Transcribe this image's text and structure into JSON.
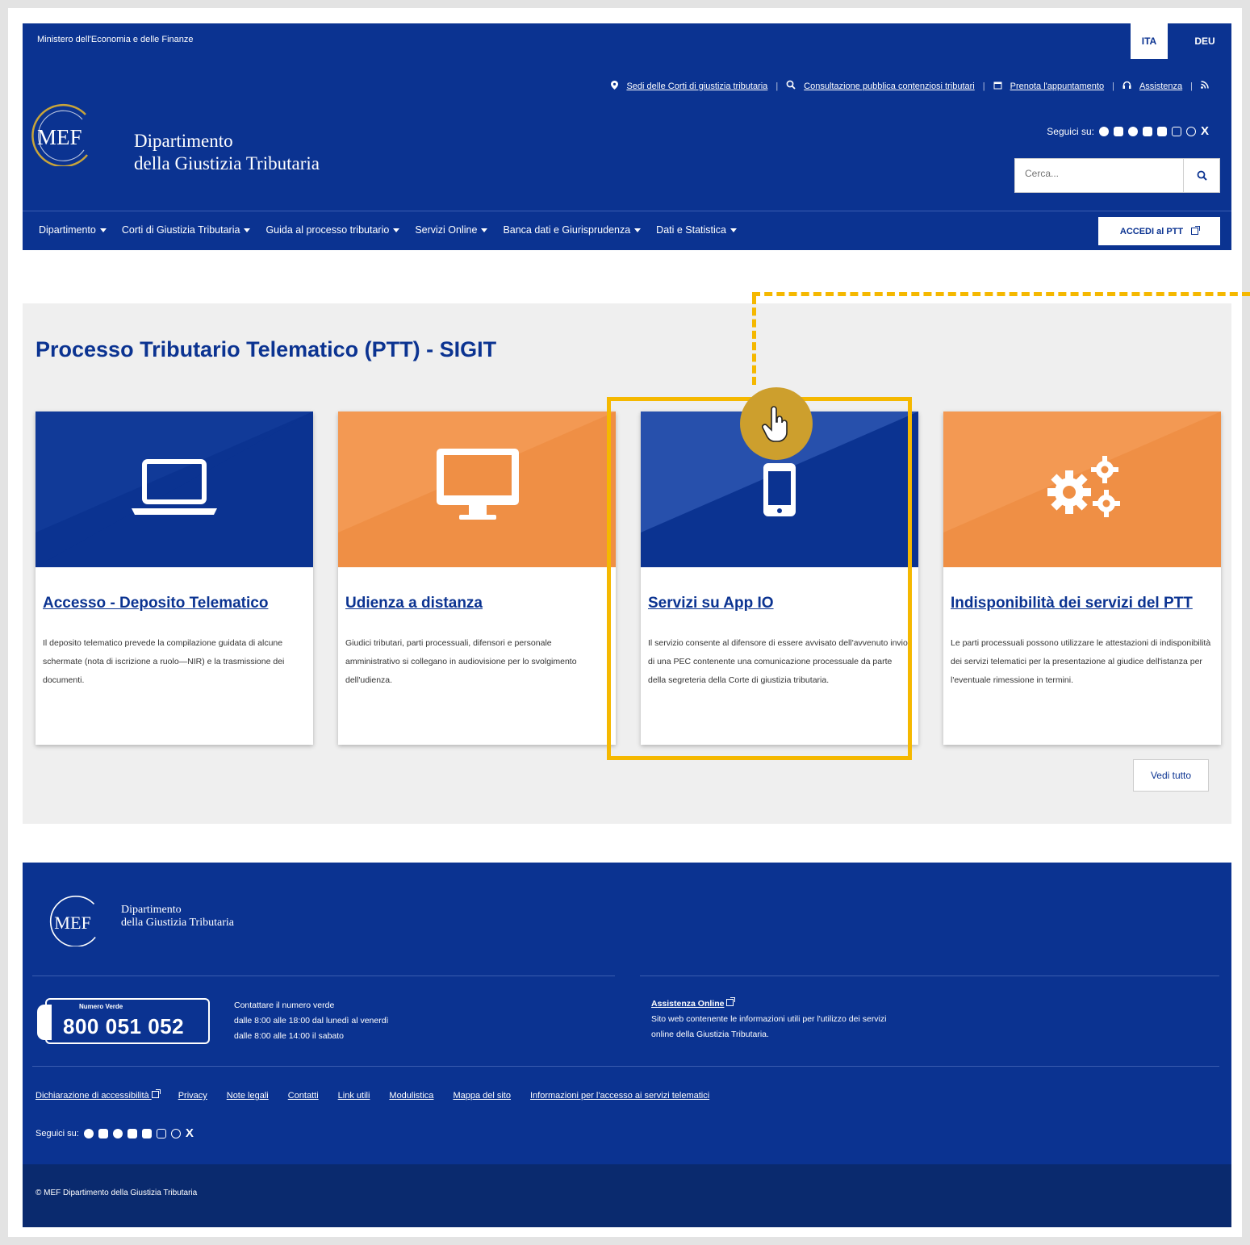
{
  "topbar": {
    "ministry": "Ministero dell'Economia e delle Finanze",
    "lang_ita": "ITA",
    "lang_deu": "DEU"
  },
  "header": {
    "links": [
      {
        "label": "Sedi delle Corti di giustizia tributaria",
        "icon": "map-pin-icon"
      },
      {
        "label": "Consultazione pubblica contenziosi tributari",
        "icon": "search-doc-icon"
      },
      {
        "label": "Prenota l'appuntamento",
        "icon": "calendar-icon"
      },
      {
        "label": "Assistenza",
        "icon": "headset-icon"
      }
    ],
    "logo_text": "MEF",
    "name_line1": "Dipartimento",
    "name_line2": "della Giustizia Tributaria",
    "follow_label": "Seguici su:",
    "search_placeholder": "Cerca..."
  },
  "nav": {
    "items": [
      "Dipartimento",
      "Corti di Giustizia Tributaria",
      "Guida al processo tributario",
      "Servizi Online",
      "Banca dati e Giurisprudenza",
      "Dati e Statistica"
    ],
    "accedi": "ACCEDI al PTT"
  },
  "section": {
    "title": "Processo Tributario Telematico (PTT) - SIGIT",
    "cards": [
      {
        "title": "Accesso - Deposito Telematico",
        "desc": "Il deposito telematico prevede la compilazione guidata di alcune schermate (nota di iscrizione a ruolo—NIR) e la trasmissione dei documenti.",
        "icon": "laptop-icon",
        "color": "#0b3391"
      },
      {
        "title": "Udienza a distanza",
        "desc": "Giudici tributari, parti processuali, difensori e personale amministrativo si collegano in audiovisione per lo svolgimento dell'udienza.",
        "icon": "monitor-icon",
        "color": "#ef8f45"
      },
      {
        "title": "Servizi su App IO",
        "desc": "Il servizio consente al difensore di essere avvisato dell'avvenuto invio di una PEC contenente una comunicazione processuale da parte della segreteria della Corte di giustizia tributaria.",
        "icon": "smartphone-icon",
        "color": "#0b3391"
      },
      {
        "title": "Indisponibilità dei servizi del PTT",
        "desc": "Le parti processuali possono utilizzare le attestazioni di indisponibilità dei servizi telematici per la presentazione al giudice dell'istanza per l'eventuale rimessione in termini.",
        "icon": "gears-icon",
        "color": "#ef8f45"
      }
    ],
    "vedi_tutto": "Vedi tutto",
    "highlight_color": "#f5b800"
  },
  "footer": {
    "name_line1": "Dipartimento",
    "name_line2": "della Giustizia Tributaria",
    "numero_verde_label": "Numero Verde",
    "numero_verde": "800 051 052",
    "contact_line1": "Contattare il numero verde",
    "contact_line2": "dalle 8:00 alle 18:00 dal lunedì al venerdì",
    "contact_line3": "dalle 8:00 alle 14:00 il sabato",
    "assist_link": "Assistenza Online",
    "assist_line1": "Sito web contenente le informazioni utili per l'utilizzo dei servizi",
    "assist_line2": "online della Giustizia Tributaria.",
    "links": [
      "Dichiarazione di accessibilità",
      "Privacy",
      "Note legali",
      "Contatti",
      "Link utili",
      "Modulistica",
      "Mappa del sito",
      "Informazioni per l'accesso ai servizi telematici"
    ],
    "follow_label": "Seguici su:",
    "copyright": "© MEF Dipartimento della Giustizia Tributaria"
  }
}
